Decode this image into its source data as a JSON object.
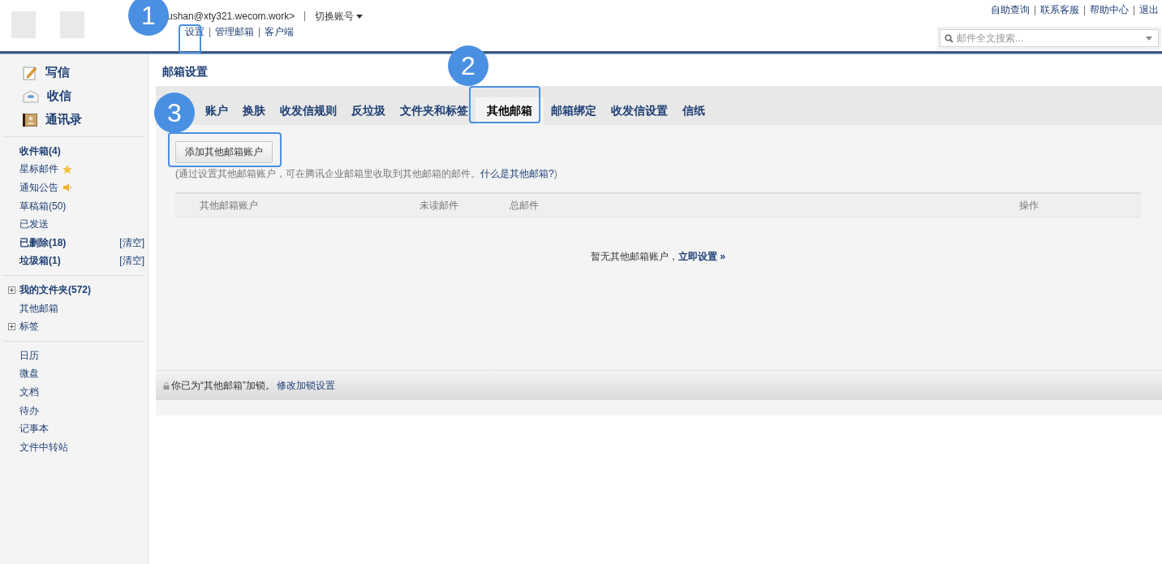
{
  "header": {
    "account": "ushan@xty321.wecom.work>",
    "switch_account": "切换账号",
    "nav": [
      "设置",
      "管理邮箱",
      "客户端"
    ],
    "top_links": [
      "自助查询",
      "联系客服",
      "帮助中心",
      "退出"
    ],
    "search": {
      "placeholder": "邮件全文搜索..."
    }
  },
  "sidebar": {
    "actions": [
      {
        "label": "写信",
        "kind": "compose"
      },
      {
        "label": "收信",
        "kind": "inbox"
      },
      {
        "label": "通讯录",
        "kind": "contacts"
      }
    ],
    "folders": [
      {
        "label": "收件箱(4)",
        "bold": true
      },
      {
        "label": "星标邮件",
        "bold": false,
        "kind": "star"
      },
      {
        "label": "通知公告",
        "bold": false,
        "kind": "speaker"
      },
      {
        "label": "草稿箱(50)",
        "bold": false
      },
      {
        "label": "已发送",
        "bold": false
      },
      {
        "label": "已删除(18)",
        "bold": true,
        "action": "[清空]"
      },
      {
        "label": "垃圾箱(1)",
        "bold": true,
        "action": "[清空]"
      }
    ],
    "groups": [
      {
        "label": "我的文件夹(572)",
        "bold": true,
        "expandable": true
      },
      {
        "label": "其他邮箱",
        "bold": false,
        "expandable": false
      },
      {
        "label": "标签",
        "bold": false,
        "expandable": true
      }
    ],
    "apps": [
      "日历",
      "微盘",
      "文档",
      "待办",
      "记事本",
      "文件中转站"
    ]
  },
  "settings": {
    "title": "邮箱设置",
    "tabs": [
      {
        "label": "账户",
        "selected": false
      },
      {
        "label": "换肤",
        "selected": false
      },
      {
        "label": "收发信规则",
        "selected": false
      },
      {
        "label": "反垃圾",
        "selected": false
      },
      {
        "label": "文件夹和标签",
        "selected": false
      },
      {
        "label": "其他邮箱",
        "selected": true
      },
      {
        "label": "邮箱绑定",
        "selected": false
      },
      {
        "label": "收发信设置",
        "selected": false
      },
      {
        "label": "信纸",
        "selected": false
      }
    ],
    "add_button": "添加其他邮箱账户",
    "description": "(通过设置其他邮箱账户，可在腾讯企业邮箱里收取到其他邮箱的邮件。",
    "help_link": "什么是其他邮箱?",
    "description_end": ")",
    "table": {
      "columns": [
        "其他邮箱账户",
        "未读邮件",
        "总邮件",
        "操作"
      ]
    },
    "empty": {
      "text": "暂无其他邮箱账户，",
      "link": "立即设置 »"
    },
    "lock": {
      "text": "你已为“其他邮箱”加锁。",
      "link": "修改加锁设置"
    }
  },
  "annotations": [
    {
      "label": "1"
    },
    {
      "label": "2"
    },
    {
      "label": "3"
    }
  ]
}
